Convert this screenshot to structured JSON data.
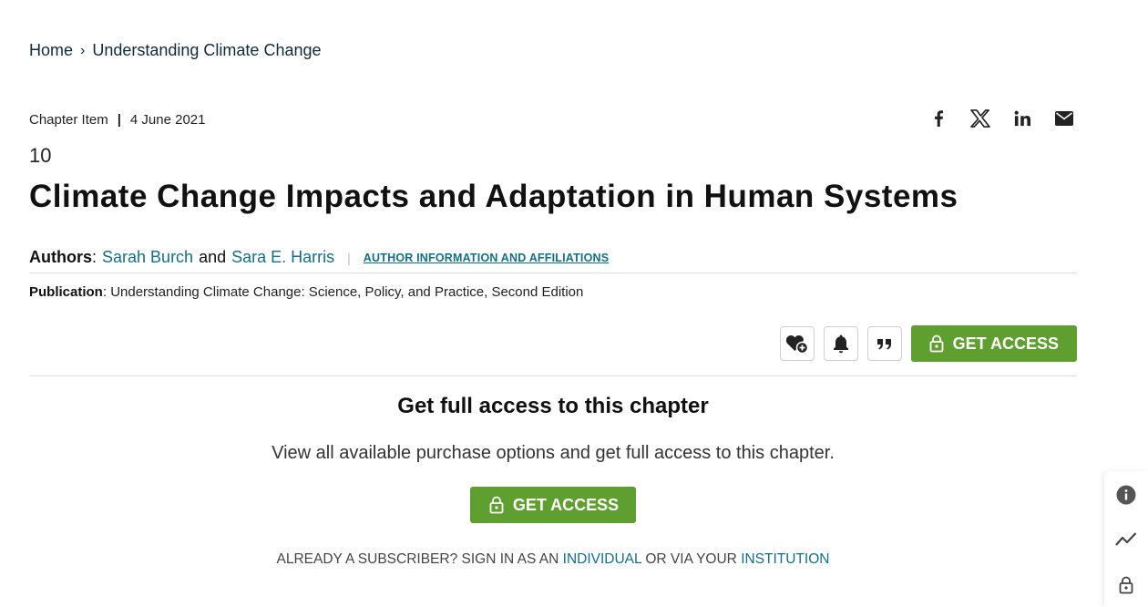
{
  "breadcrumb": {
    "home": "Home",
    "separator": "›",
    "current": "Understanding Climate Change"
  },
  "meta": {
    "type": "Chapter Item",
    "separator": "|",
    "date": "4 June 2021"
  },
  "share_icons": [
    "facebook-icon",
    "x-icon",
    "linkedin-icon",
    "email-icon"
  ],
  "chapter": {
    "number": "10",
    "title": "Climate Change Impacts and Adaptation in Human Systems"
  },
  "authors": {
    "label": "Authors",
    "colon": ":",
    "author1": "Sarah Burch",
    "conjunction": "and",
    "author2": "Sara E. Harris",
    "pipe": "|",
    "affiliations_link": "AUTHOR INFORMATION AND AFFILIATIONS"
  },
  "publication": {
    "label": "Publication",
    "colon": ":",
    "value": "Understanding Climate Change: Science, Policy, and Practice, Second Edition"
  },
  "toolbar": {
    "icons": [
      "favorite-add-icon",
      "alert-bell-icon",
      "cite-quote-icon"
    ],
    "get_access_label": "GET ACCESS"
  },
  "cta": {
    "title": "Get full access to this chapter",
    "subtitle": "View all available purchase options and get full access to this chapter.",
    "button_label": "GET ACCESS",
    "footer_prefix": "ALREADY A SUBSCRIBER? SIGN IN AS AN",
    "individual_link": "INDIVIDUAL",
    "footer_middle": "OR VIA YOUR",
    "institution_link": "INSTITUTION"
  },
  "side_panel": {
    "icons": [
      "info-icon",
      "metrics-trend-icon",
      "lock-icon"
    ]
  },
  "colors": {
    "accent_green": "#5f9f2f",
    "link_teal": "#10708a",
    "breadcrumb_navy": "#0f2a3f"
  }
}
